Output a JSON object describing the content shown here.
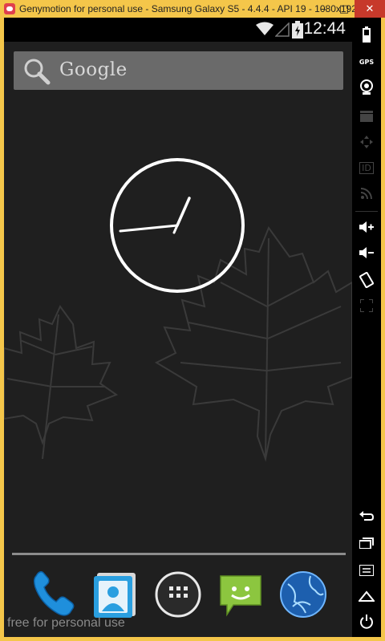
{
  "window": {
    "title": "Genymotion for personal use - Samsung Galaxy S5 - 4.4.4 - API 19 - 1080x1920 ...",
    "minimize_glyph": "–",
    "maximize_glyph": "□",
    "close_glyph": "✕"
  },
  "statusbar": {
    "time": "12:44",
    "icons": [
      "wifi-icon",
      "signal-icon",
      "battery-charging-icon"
    ]
  },
  "search": {
    "label": "Google",
    "icon": "search-icon"
  },
  "clock": {
    "type": "analog",
    "time": "12:44"
  },
  "dock": {
    "apps": [
      "Phone",
      "Contacts",
      "All apps",
      "Messaging",
      "Browser"
    ]
  },
  "watermark": "free for personal use",
  "sidebar": {
    "items": [
      "battery-icon",
      "gps-icon",
      "camera-icon",
      "capture-icon",
      "dpad-icon",
      "id-icon",
      "rss-icon",
      "volume-up-icon",
      "volume-down-icon",
      "rotate-icon",
      "fullscreen-icon",
      "back-icon",
      "recent-apps-icon",
      "menu-icon",
      "home-icon",
      "power-icon"
    ],
    "gps_label": "GPS",
    "id_label": "ID"
  },
  "colors": {
    "window_frame": "#f4c64a",
    "screen_bg": "#1f1f1f",
    "close_button": "#c7392b"
  }
}
